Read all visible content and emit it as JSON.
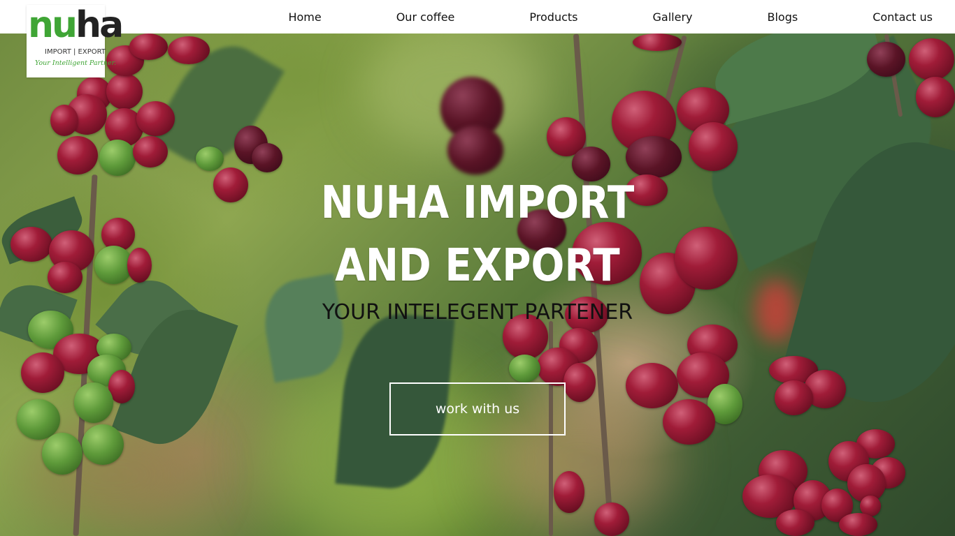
{
  "logo": {
    "word_green": "nu",
    "word_dark": "ha",
    "subtitle": "IMPORT | EXPORT",
    "tagline": "Your Intelligent Partner."
  },
  "nav": {
    "items": [
      {
        "label": "Home"
      },
      {
        "label": "Our coffee"
      },
      {
        "label": "Products"
      },
      {
        "label": "Gallery"
      },
      {
        "label": "Blogs"
      },
      {
        "label": "Contact us"
      }
    ]
  },
  "hero": {
    "title": "NUHA IMPORT AND EXPORT",
    "subtitle": "YOUR INTELEGENT PARTENER",
    "cta_label": "work with us"
  },
  "colors": {
    "brand_green": "#3fa535",
    "header_bg": "#ffffff",
    "cta_border": "#ffffff"
  }
}
